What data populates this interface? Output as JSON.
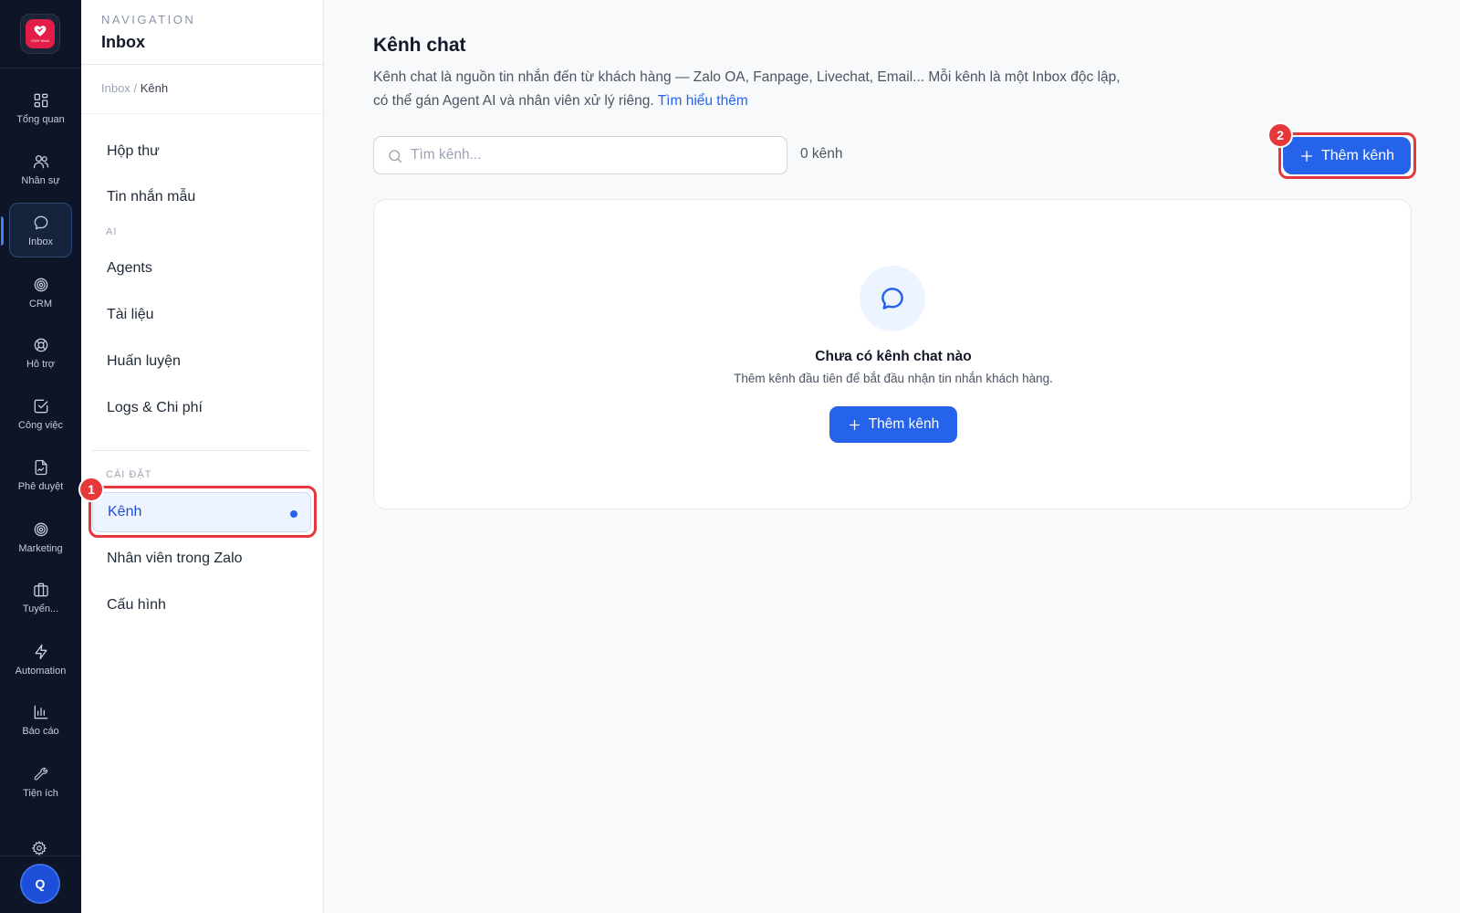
{
  "rail": {
    "logo_text": "CWV Work",
    "items": [
      {
        "label": "Tổng quan",
        "icon": "dashboard-icon"
      },
      {
        "label": "Nhân sự",
        "icon": "users-icon"
      },
      {
        "label": "Inbox",
        "icon": "chat-icon"
      },
      {
        "label": "CRM",
        "icon": "target-icon"
      },
      {
        "label": "Hỗ trợ",
        "icon": "lifebuoy-icon"
      },
      {
        "label": "Công việc",
        "icon": "checkbox-icon"
      },
      {
        "label": "Phê duyệt",
        "icon": "document-sign-icon"
      },
      {
        "label": "Marketing",
        "icon": "target-icon"
      },
      {
        "label": "Tuyển...",
        "icon": "briefcase-icon"
      },
      {
        "label": "Automation",
        "icon": "lightning-icon"
      },
      {
        "label": "Báo cáo",
        "icon": "bar-chart-icon"
      },
      {
        "label": "Tiện ích",
        "icon": "wrench-icon"
      }
    ],
    "active": "Inbox",
    "avatar_initial": "Q"
  },
  "subnav": {
    "caption": "NAVIGATION",
    "title": "Inbox",
    "breadcrumb": {
      "parent": "Inbox",
      "separator": "/",
      "current": "Kênh"
    },
    "items_top": [
      {
        "label": "Hộp thư"
      },
      {
        "label": "Tin nhắn mẫu"
      }
    ],
    "section_ai": "AI",
    "items_ai": [
      {
        "label": "Agents"
      },
      {
        "label": "Tài liệu"
      },
      {
        "label": "Huấn luyện"
      },
      {
        "label": "Logs & Chi phí"
      }
    ],
    "section_settings": "CÀI ĐẶT",
    "items_settings": [
      {
        "label": "Kênh",
        "active": true
      },
      {
        "label": "Nhân viên trong Zalo"
      },
      {
        "label": "Cấu hình"
      }
    ]
  },
  "annotations": [
    {
      "number": "1",
      "color": "#e5383b"
    },
    {
      "number": "2",
      "color": "#e5383b"
    }
  ],
  "main": {
    "title": "Kênh chat",
    "description_line1": "Kênh chat là nguồn tin nhắn đến từ khách hàng — Zalo OA, Fanpage, Livechat, Email... Mỗi kênh là một Inbox độc lập,",
    "description_line2": "có thể gán Agent AI và nhân viên xử lý riêng.",
    "learn_more": "Tìm hiểu thêm",
    "search_placeholder": "Tìm kênh...",
    "count": "0 kênh",
    "add_button": "Thêm kênh",
    "empty": {
      "icon": "chat-bubble-icon",
      "title": "Chưa có kênh chat nào",
      "subtitle": "Thêm kênh đầu tiên để bắt đầu nhận tin nhắn khách hàng.",
      "button": "Thêm kênh"
    }
  },
  "colors": {
    "rail_bg": "#0d1526",
    "accent": "#2563eb",
    "highlight": "#e5383b"
  }
}
